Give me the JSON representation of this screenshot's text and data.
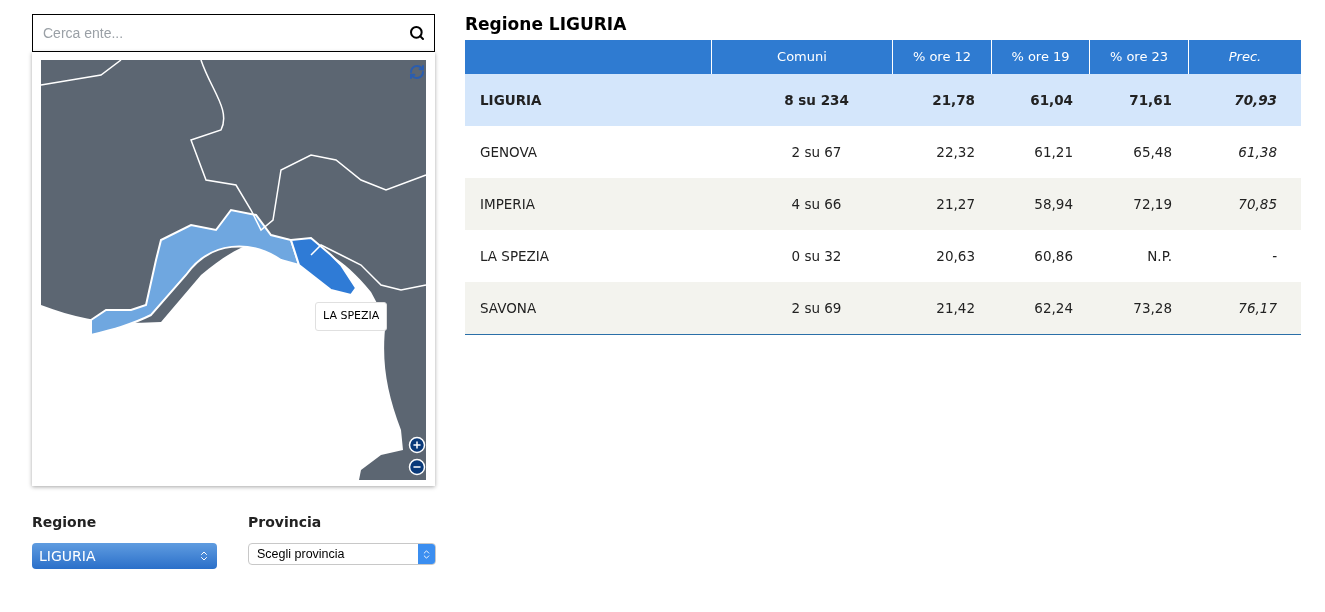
{
  "search": {
    "placeholder": "Cerca ente..."
  },
  "map": {
    "tooltip": "LA SPEZIA"
  },
  "filters": [
    {
      "label": "Regione",
      "value": "LIGURIA",
      "kind": "active"
    },
    {
      "label": "Provincia",
      "value": "Scegli provincia",
      "kind": "plain"
    }
  ],
  "title": "Regione LIGURIA",
  "table": {
    "columns": [
      "",
      "Comuni",
      "% ore 12",
      "% ore 19",
      "% ore 23",
      "Prec."
    ],
    "rows": [
      {
        "kind": "total",
        "cells": [
          "LIGURIA",
          "8 su 234",
          "21,78",
          "61,04",
          "71,61",
          "70,93"
        ]
      },
      {
        "kind": "province",
        "cells": [
          "GENOVA",
          "2 su 67",
          "22,32",
          "61,21",
          "65,48",
          "61,38"
        ]
      },
      {
        "kind": "province",
        "cells": [
          "IMPERIA",
          "4 su 66",
          "21,27",
          "58,94",
          "72,19",
          "70,85"
        ]
      },
      {
        "kind": "province",
        "cells": [
          "LA SPEZIA",
          "0 su 32",
          "20,63",
          "60,86",
          "N.P.",
          "-"
        ]
      },
      {
        "kind": "province",
        "cells": [
          "SAVONA",
          "2 su 69",
          "21,42",
          "62,24",
          "73,28",
          "76,17"
        ]
      }
    ]
  }
}
